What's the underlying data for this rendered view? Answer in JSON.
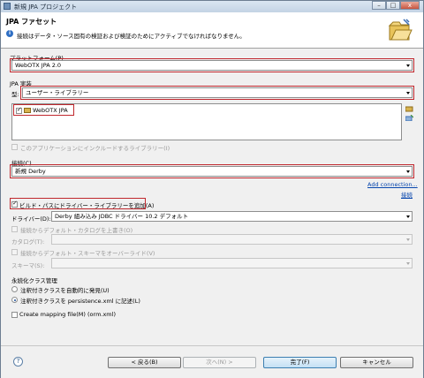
{
  "window": {
    "title": "新規 JPA プロジェクト",
    "minimize": "–",
    "maximize": "□",
    "close": "x"
  },
  "header": {
    "title": "JPA ファセット",
    "message": "接続はデータ・ソース固有の検証および検証のためにアクティブでなければなりません。",
    "info_icon": "i"
  },
  "platform": {
    "label": "プラットフォーム(P)",
    "value": "WebOTX JPA 2.0"
  },
  "impl": {
    "section_label": "JPA 実装",
    "type_label": "型:",
    "type_value": "ユーザー・ライブラリー",
    "library_item": "WebOTX JPA",
    "include_label": "このアプリケーションにインクルードするライブラリー(I)"
  },
  "connection": {
    "label": "接続(C)",
    "value": "新規 Derby",
    "add_link": "Add connection...",
    "connect_link": "接続"
  },
  "driver": {
    "add_to_buildpath": "ビルド・パスにドライバー・ライブラリーを追加(A)",
    "driver_label": "ドライバー(D):",
    "driver_value": "Derby 組み込み JDBC ドライバー 10.2 デフォルト",
    "override_catalog": "接続からデフォルト・カタログを上書き(O)",
    "catalog_label": "カタログ(T):",
    "override_schema": "接続からデフォルト・スキーマをオーバーライド(V)",
    "schema_label": "スキーマ(S):"
  },
  "persistent": {
    "section_label": "永続化クラス管理",
    "option_discover": "注釈付きクラスを自動的に発見(U)",
    "option_list": "注釈付きクラスを persistence.xml に記述(L)"
  },
  "mapping": {
    "label": "Create mapping file(M) (orm.xml)"
  },
  "footer": {
    "help_icon": "?",
    "back": "< 戻る(B)",
    "next": "次へ(N) >",
    "finish": "完了(F)",
    "cancel": "キャンセル"
  }
}
